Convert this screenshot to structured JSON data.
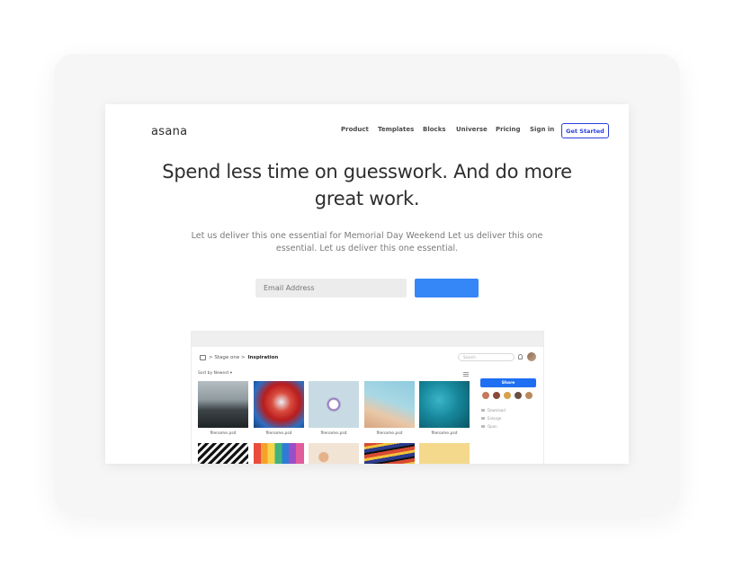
{
  "site": {
    "logo": "asana",
    "nav": [
      "Product",
      "Templates",
      "Blocks",
      "Universe",
      "Pricing",
      "Sign in"
    ],
    "cta": "Get Started"
  },
  "hero": {
    "title": "Spend less time on guesswork. And do more great work.",
    "subtitle": "Let us deliver this one essential for Memorial Day Weekend Let us deliver this one essential. Let us deliver this one essential.",
    "email_placeholder": "Email Address",
    "submit_label": ""
  },
  "app_preview": {
    "breadcrumb_root": "> Stage one >",
    "breadcrumb_current": "Inspiration",
    "search_placeholder": "Search",
    "sort_label": "Sort by Newest",
    "sort_caret": "▾",
    "share_label": "Share",
    "actions": [
      "Download",
      "Enlarge",
      "Open"
    ],
    "files": [
      {
        "name": "filename.psd"
      },
      {
        "name": "filename.psd"
      },
      {
        "name": "filename.psd"
      },
      {
        "name": "filename.psd"
      },
      {
        "name": "filename.psd"
      }
    ]
  },
  "colors": {
    "accent": "#2b3fe0",
    "submit": "#3586f7",
    "share": "#1f6ff2"
  }
}
